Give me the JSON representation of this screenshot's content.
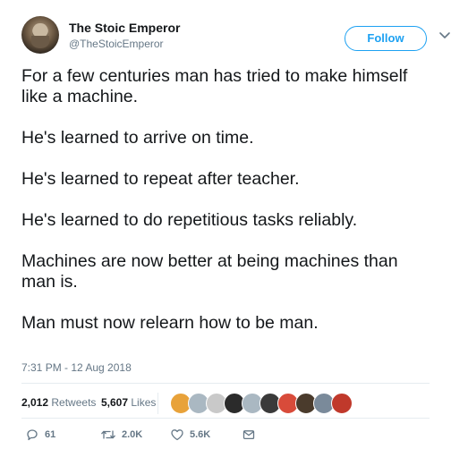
{
  "user": {
    "display_name": "The Stoic Emperor",
    "handle": "@TheStoicEmperor"
  },
  "follow_label": "Follow",
  "tweet": {
    "paragraphs": [
      "For a few centuries man has tried to make himself like a machine.",
      "He's learned to arrive on time.",
      "He's learned to repeat after teacher.",
      "He's learned to do repetitious tasks reliably.",
      "Machines are now better at being machines than man is.",
      "Man must now relearn how to be man."
    ],
    "timestamp": "7:31 PM - 12 Aug 2018"
  },
  "stats": {
    "retweets_count": "2,012",
    "retweets_label": "Retweets",
    "likes_count": "5,607",
    "likes_label": "Likes"
  },
  "likers": [
    {
      "name": "liker-avatar-1",
      "color": "#e8a23a"
    },
    {
      "name": "liker-avatar-2",
      "color": "#aab8c2"
    },
    {
      "name": "liker-avatar-3",
      "color": "#c9c9c9"
    },
    {
      "name": "liker-avatar-4",
      "color": "#2b2b2b"
    },
    {
      "name": "liker-avatar-5",
      "color": "#aab8c2"
    },
    {
      "name": "liker-avatar-6",
      "color": "#3a3a3a"
    },
    {
      "name": "liker-avatar-7",
      "color": "#d84b3a"
    },
    {
      "name": "liker-avatar-8",
      "color": "#4a3b2c"
    },
    {
      "name": "liker-avatar-9",
      "color": "#7a8a9a"
    },
    {
      "name": "liker-avatar-10",
      "color": "#c0392b"
    }
  ],
  "actions": {
    "reply_count": "61",
    "retweet_count": "2.0K",
    "like_count": "5.6K"
  },
  "colors": {
    "accent": "#1da1f2",
    "secondary_text": "#657786",
    "divider": "#e6ecf0"
  },
  "icons": {
    "reply": "reply-icon",
    "retweet": "retweet-icon",
    "like": "heart-icon",
    "message": "envelope-icon",
    "more": "chevron-down-icon"
  }
}
